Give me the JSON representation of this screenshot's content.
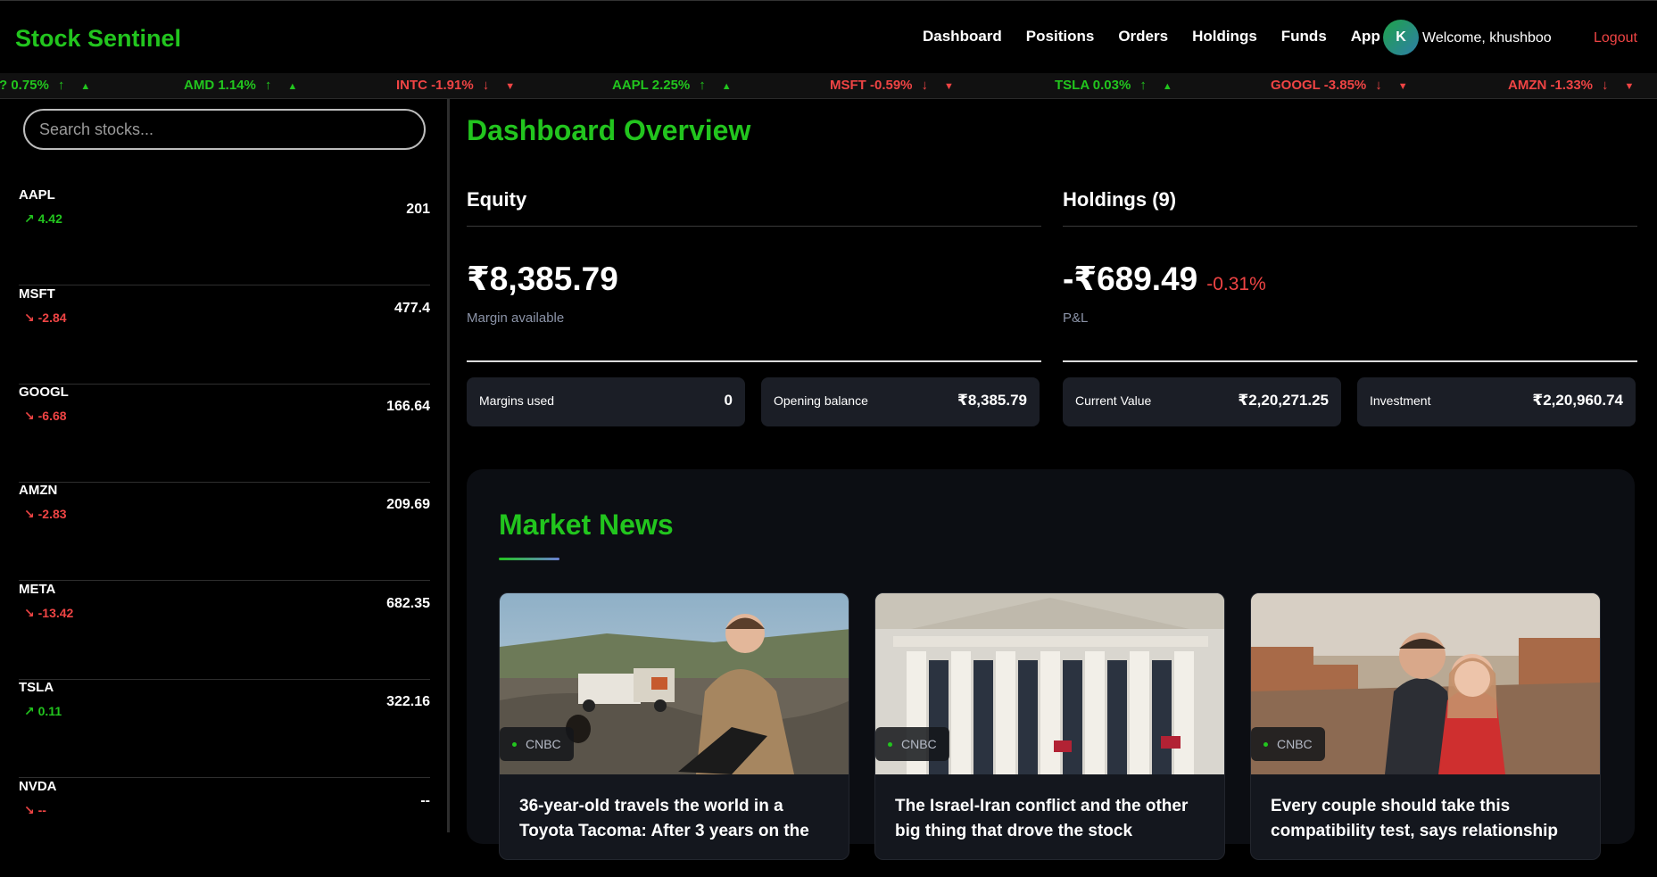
{
  "navbar": {
    "brand": "Stock Sentinel",
    "links": [
      "Dashboard",
      "Positions",
      "Orders",
      "Holdings",
      "Funds",
      "App"
    ],
    "avatar_initial": "K",
    "welcome": "Welcome, khushboo",
    "logout": "Logout"
  },
  "ticker": [
    {
      "text": "? 0.75%",
      "dir": "up"
    },
    {
      "text": "AMD 1.14%",
      "dir": "up"
    },
    {
      "text": "INTC -1.91%",
      "dir": "down"
    },
    {
      "text": "AAPL 2.25%",
      "dir": "up"
    },
    {
      "text": "MSFT -0.59%",
      "dir": "down"
    },
    {
      "text": "TSLA 0.03%",
      "dir": "up"
    },
    {
      "text": "GOOGL -3.85%",
      "dir": "down"
    },
    {
      "text": "AMZN -1.33%",
      "dir": "down"
    }
  ],
  "sidebar": {
    "search_placeholder": "Search stocks...",
    "stocks": [
      {
        "symbol": "AAPL",
        "change": "4.42",
        "dir": "up",
        "price": "201"
      },
      {
        "symbol": "MSFT",
        "change": "-2.84",
        "dir": "down",
        "price": "477.4"
      },
      {
        "symbol": "GOOGL",
        "change": "-6.68",
        "dir": "down",
        "price": "166.64"
      },
      {
        "symbol": "AMZN",
        "change": "-2.83",
        "dir": "down",
        "price": "209.69"
      },
      {
        "symbol": "META",
        "change": "-13.42",
        "dir": "down",
        "price": "682.35"
      },
      {
        "symbol": "TSLA",
        "change": "0.11",
        "dir": "up",
        "price": "322.16"
      },
      {
        "symbol": "NVDA",
        "change": "--",
        "dir": "down",
        "price": "--"
      }
    ]
  },
  "main": {
    "title": "Dashboard Overview",
    "equity": {
      "title": "Equity",
      "value": "₹8,385.79",
      "label": "Margin available",
      "cards": [
        {
          "label": "Margins used",
          "value": "0"
        },
        {
          "label": "Opening balance",
          "value": "₹8,385.79"
        }
      ]
    },
    "holdings": {
      "title": "Holdings (9)",
      "value": "-₹689.49",
      "pct": "-0.31%",
      "label": "P&L",
      "cards": [
        {
          "label": "Current Value",
          "value": "₹2,20,271.25"
        },
        {
          "label": "Investment",
          "value": "₹2,20,960.74"
        }
      ]
    },
    "news": {
      "title": "Market News",
      "items": [
        {
          "source": "CNBC",
          "headline": "36-year-old travels the world in a Toyota Tacoma: After 3 years on the"
        },
        {
          "source": "CNBC",
          "headline": "The Israel-Iran conflict and the other big thing that drove the stock"
        },
        {
          "source": "CNBC",
          "headline": "Every couple should take this compatibility test, says relationship"
        }
      ]
    }
  }
}
